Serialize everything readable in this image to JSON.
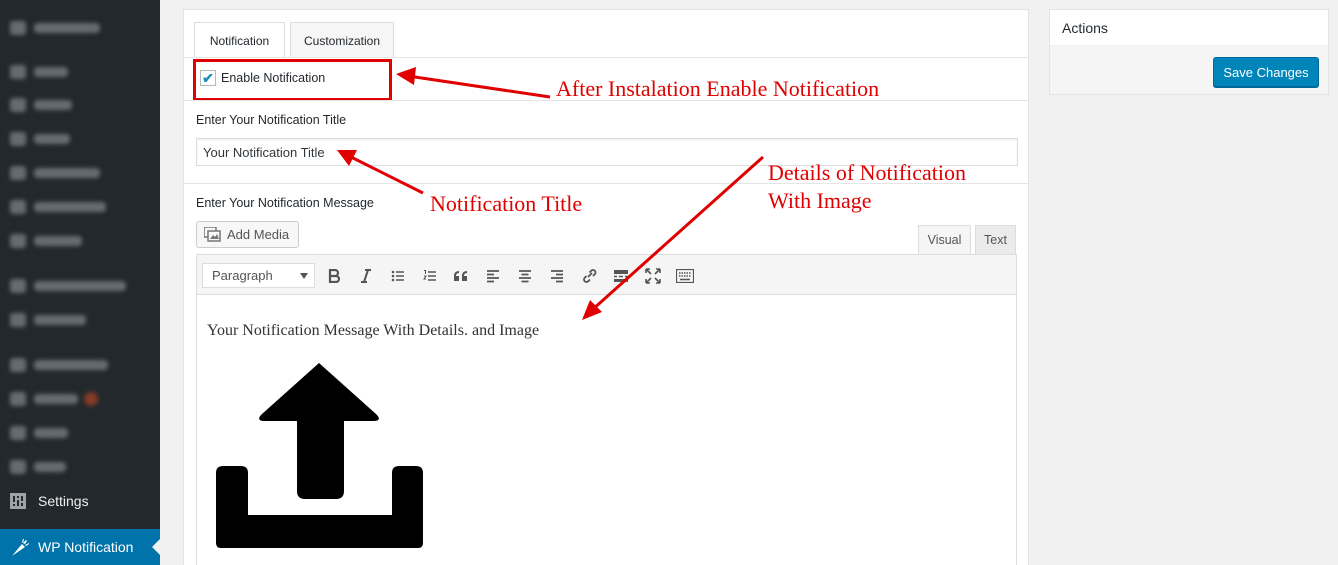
{
  "sidebar": {
    "items": [
      {
        "label": "Dashboard",
        "icon": "dashboard-icon",
        "blurred": true
      },
      {
        "label": "Posts",
        "icon": "pin-icon",
        "blurred": true
      },
      {
        "label": "Media",
        "icon": "media-icon",
        "blurred": true
      },
      {
        "label": "Pages",
        "icon": "pages-icon",
        "blurred": true
      },
      {
        "label": "Comments",
        "icon": "comments-icon",
        "blurred": true
      },
      {
        "label": "NS Cloud Image",
        "icon": "image-icon",
        "blurred": true
      },
      {
        "label": "Contact",
        "icon": "mail-icon",
        "blurred": true
      },
      {
        "label": "WooCommerce",
        "icon": "woo-icon",
        "blurred": true
      },
      {
        "label": "Products",
        "icon": "products-icon",
        "blurred": true
      },
      {
        "label": "Appearance",
        "icon": "brush-icon",
        "blurred": true
      },
      {
        "label": "Plugins",
        "icon": "plugins-icon",
        "blurred": true
      },
      {
        "label": "Users",
        "icon": "users-icon",
        "blurred": true
      },
      {
        "label": "Tools",
        "icon": "tools-icon",
        "blurred": true
      }
    ],
    "settings_label": "Settings",
    "active_label": "WP Notification"
  },
  "tabs": {
    "notification": "Notification",
    "customization": "Customization"
  },
  "form": {
    "enable_label": "Enable Notification",
    "enable_checked": true,
    "title_label": "Enter Your Notification Title",
    "title_value": "Your Notification Title",
    "message_label": "Enter Your Notification Message",
    "add_media_label": "Add Media",
    "visual_tab": "Visual",
    "text_tab": "Text",
    "format_value": "Paragraph",
    "editor_text": "Your Notification Message With Details. and Image"
  },
  "toolbar_icons": [
    "bold-icon",
    "italic-icon",
    "bullet-list-icon",
    "numbered-list-icon",
    "blockquote-icon",
    "align-left-icon",
    "align-center-icon",
    "align-right-icon",
    "link-icon",
    "read-more-icon",
    "fullscreen-icon",
    "keyboard-icon"
  ],
  "actions": {
    "title": "Actions",
    "save_label": "Save Changes"
  },
  "annotations": {
    "enable_note": "After Instalation Enable Notification",
    "title_note": "Notification Title",
    "details_note_line1": "Details of Notification",
    "details_note_line2": "With Image"
  },
  "colors": {
    "sidebar_bg": "#23282d",
    "active_bg": "#0073aa",
    "button_blue": "#0085ba",
    "annotation_red": "#e00000"
  }
}
